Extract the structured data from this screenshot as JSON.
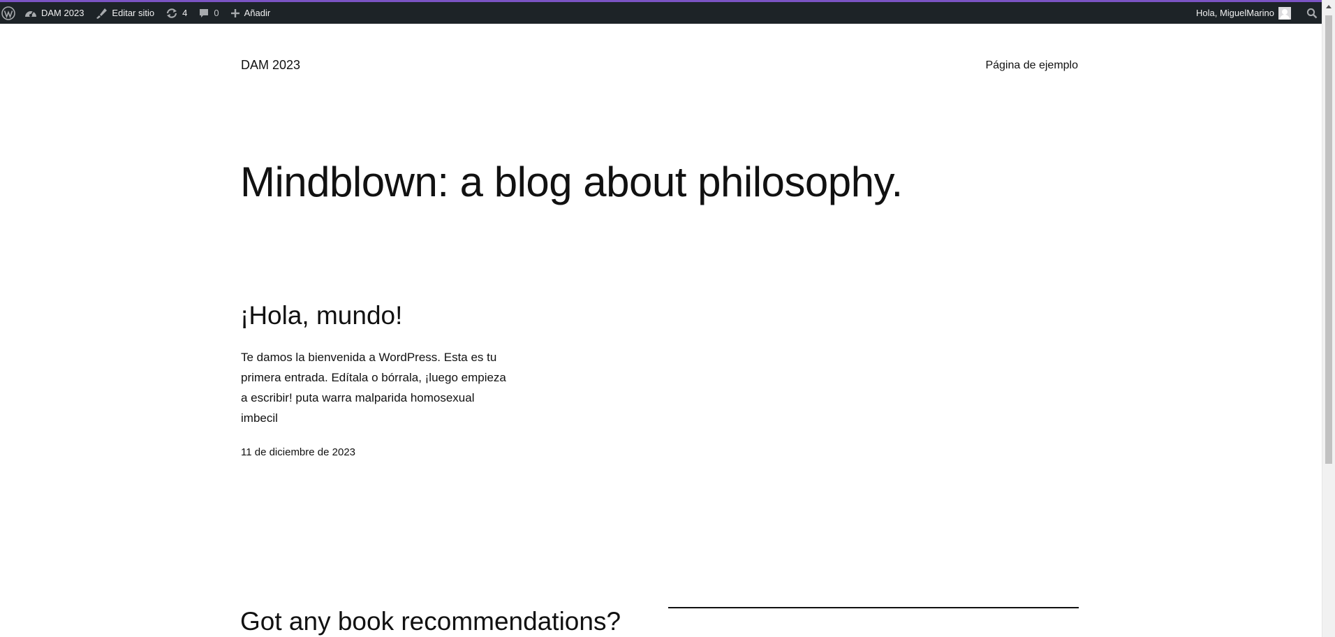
{
  "adminbar": {
    "site_name": "DAM 2023",
    "edit_site_label": "Editar sitio",
    "updates_count": "4",
    "comments_count": "0",
    "new_label": "Añadir",
    "greeting": "Hola, MiguelMarino",
    "accent_color": "#7b54c3"
  },
  "header": {
    "site_title": "DAM 2023",
    "nav_items": [
      "Página de ejemplo"
    ]
  },
  "hero": {
    "title": "Mindblown: a blog about philosophy."
  },
  "posts": [
    {
      "title": "¡Hola, mundo!",
      "excerpt": "Te damos la bienvenida a WordPress. Esta es tu primera entrada. Edítala o bórrala, ¡luego empieza a escribir! puta warra malparida homosexual imbecil",
      "date": "11 de diciembre de 2023"
    },
    {
      "title": "Got any book recommendations?"
    }
  ],
  "icons": {
    "wordpress": "wordpress-logo-icon",
    "dashboard": "dashboard-icon",
    "edit": "edit-brush-icon",
    "updates": "updates-icon",
    "comments": "comment-icon",
    "add": "plus-icon",
    "avatar": "avatar-icon",
    "search": "search-icon"
  }
}
